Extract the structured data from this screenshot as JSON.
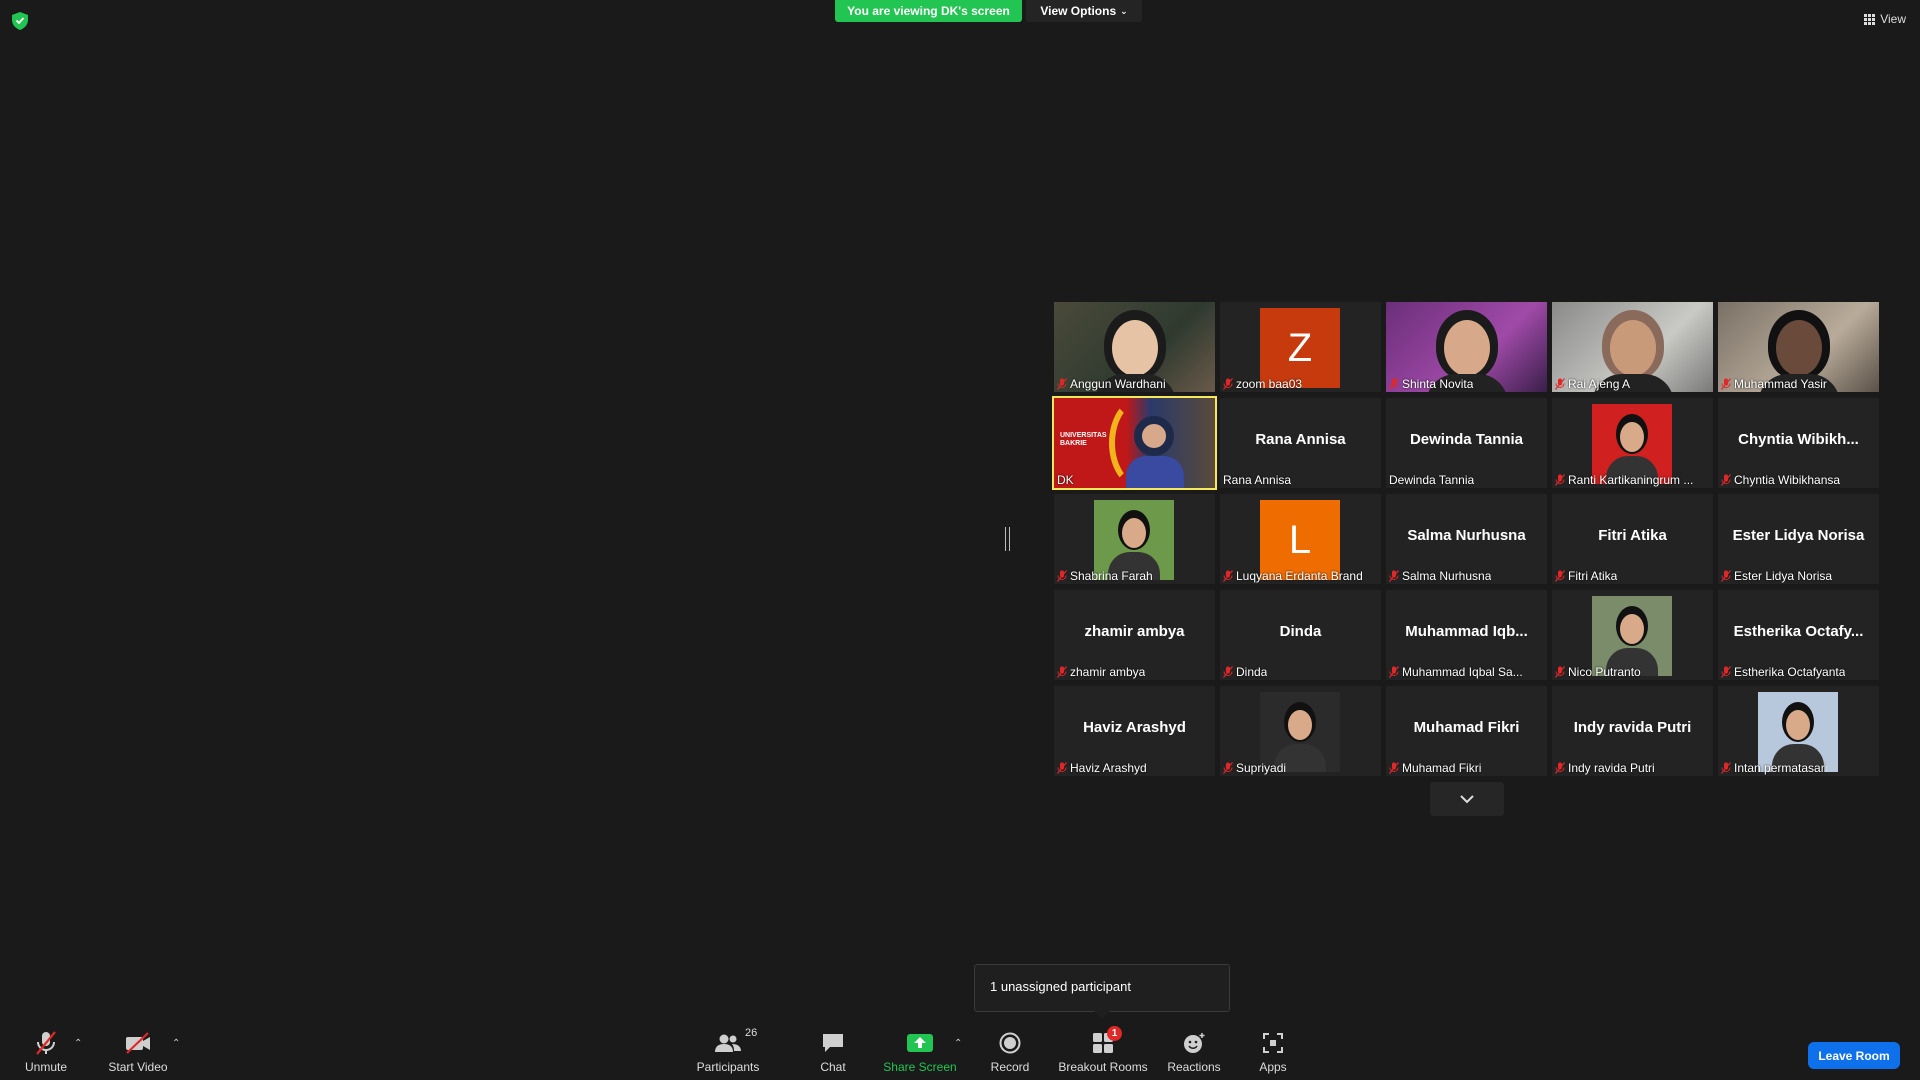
{
  "top": {
    "banner": "You are viewing DK's screen",
    "view_options": "View Options",
    "view": "View"
  },
  "gallery": [
    {
      "name": "Anggun Wardhani",
      "muted": true,
      "kind": "photo"
    },
    {
      "name": "zoom baa03",
      "muted": true,
      "kind": "letter",
      "letter": "Z",
      "color": "#c73a0e"
    },
    {
      "name": "Shinta Novita",
      "muted": true,
      "kind": "photo"
    },
    {
      "name": "Rai Ajeng A",
      "muted": true,
      "kind": "photo"
    },
    {
      "name": "Muhammad Yasir",
      "muted": true,
      "kind": "photo"
    },
    {
      "name": "DK",
      "muted": false,
      "kind": "photo",
      "active": true
    },
    {
      "name": "Rana Annisa",
      "muted": false,
      "kind": "text",
      "big": "Rana Annisa"
    },
    {
      "name": "Dewinda Tannia",
      "muted": false,
      "kind": "text",
      "big": "Dewinda Tannia"
    },
    {
      "name": "Ranti Kartikaningrum ...",
      "muted": true,
      "kind": "avatar"
    },
    {
      "name": "Chyntia Wibikhansa",
      "muted": true,
      "kind": "text",
      "big": "Chyntia  Wibikh..."
    },
    {
      "name": "Shabrina Farah",
      "muted": true,
      "kind": "avatar"
    },
    {
      "name": "Luqyana Erdanta Brand",
      "muted": true,
      "kind": "letter",
      "letter": "L",
      "color": "#ef6c00"
    },
    {
      "name": "Salma Nurhusna",
      "muted": true,
      "kind": "text",
      "big": "Salma Nurhusna"
    },
    {
      "name": "Fitri Atika",
      "muted": true,
      "kind": "text",
      "big": "Fitri Atika"
    },
    {
      "name": "Ester Lidya Norisa",
      "muted": true,
      "kind": "text",
      "big": "Ester Lidya Norisa"
    },
    {
      "name": "zhamir ambya",
      "muted": true,
      "kind": "text",
      "big": "zhamir ambya"
    },
    {
      "name": "Dinda",
      "muted": true,
      "kind": "text",
      "big": "Dinda"
    },
    {
      "name": "Muhammad Iqbal Sa...",
      "muted": true,
      "kind": "text",
      "big": "Muhammad  Iqb..."
    },
    {
      "name": "Nico Putranto",
      "muted": true,
      "kind": "avatar"
    },
    {
      "name": "Estherika Octafyanta",
      "muted": true,
      "kind": "text",
      "big": "Estherika  Octafy..."
    },
    {
      "name": "Haviz Arashyd",
      "muted": true,
      "kind": "text",
      "big": "Haviz Arashyd"
    },
    {
      "name": "Supriyadi",
      "muted": true,
      "kind": "avatar"
    },
    {
      "name": "Muhamad Fikri",
      "muted": true,
      "kind": "text",
      "big": "Muhamad Fikri"
    },
    {
      "name": "Indy ravida Putri",
      "muted": true,
      "kind": "text",
      "big": "Indy ravida Putri"
    },
    {
      "name": "Intan permatasari",
      "muted": true,
      "kind": "avatar"
    }
  ],
  "dk_slide": {
    "line1": "UNIVERSITAS",
    "line2": "BAKRIE"
  },
  "tooltip": "1 unassigned participant",
  "toolbar": {
    "unmute": "Unmute",
    "start_video": "Start Video",
    "participants": "Participants",
    "participants_count": "26",
    "chat": "Chat",
    "share_screen": "Share Screen",
    "record": "Record",
    "breakout_rooms": "Breakout Rooms",
    "breakout_badge": "1",
    "reactions": "Reactions",
    "apps": "Apps",
    "leave_room": "Leave Room"
  },
  "colors": {
    "banner": "#23c552",
    "active_border": "#f5e85a",
    "leave": "#0e71eb",
    "muted_mic": "#e02828"
  }
}
